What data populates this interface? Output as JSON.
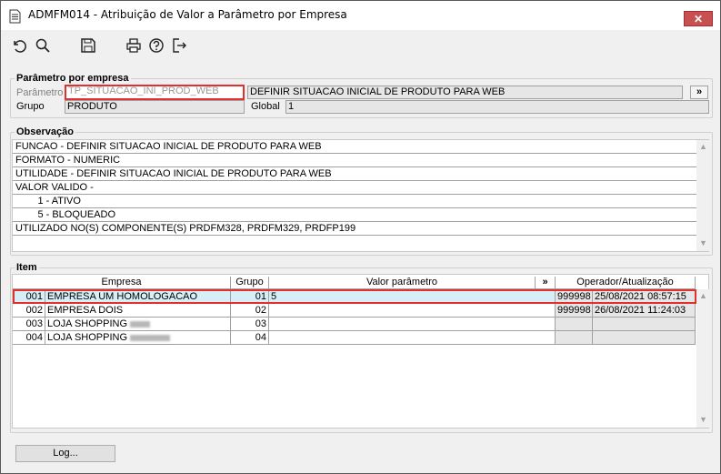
{
  "window": {
    "title": "ADMFM014 - Atribuição de Valor a Parâmetro por Empresa",
    "close_label": "✕"
  },
  "toolbar": {
    "icons": [
      "undo-icon",
      "search-icon",
      "save-icon",
      "print-icon",
      "help-icon",
      "exit-icon"
    ]
  },
  "parametro": {
    "legend": "Parâmetro por empresa",
    "parametro_label": "Parâmetro",
    "parametro_value": "TP_SITUACAO_INI_PROD_WEB",
    "descricao_value": "DEFINIR SITUACAO INICIAL DE PRODUTO PARA WEB",
    "lookup_label": "»",
    "grupo_label": "Grupo",
    "grupo_value": "PRODUTO",
    "global_label": "Global",
    "global_value": "1"
  },
  "observacao": {
    "legend": "Observação",
    "lines": [
      "FUNCAO - DEFINIR SITUACAO INICIAL DE PRODUTO PARA WEB",
      "FORMATO - NUMERIC",
      "UTILIDADE - DEFINIR SITUACAO INICIAL DE PRODUTO PARA WEB",
      "VALOR VALIDO -",
      "        1 - ATIVO",
      "        5 - BLOQUEADO",
      "UTILIZADO NO(S) COMPONENTE(S) PRDFM328, PRDFM329, PRDFP199"
    ]
  },
  "item": {
    "legend": "Item",
    "headers": {
      "empresa": "Empresa",
      "grupo": "Grupo",
      "valor": "Valor parâmetro",
      "expand": "»",
      "operador": "Operador/Atualização"
    },
    "rows": [
      {
        "code": "001",
        "name": "EMPRESA UM HOMOLOGACAO",
        "grupo": "01",
        "valor": "5",
        "operador": "999998",
        "data": "25/08/2021 08:57:15"
      },
      {
        "code": "002",
        "name": "EMPRESA DOIS",
        "grupo": "02",
        "valor": "",
        "operador": "999998",
        "data": "26/08/2021 11:24:03"
      },
      {
        "code": "003",
        "name": "LOJA SHOPPING",
        "grupo": "03",
        "valor": "",
        "operador": "",
        "data": ""
      },
      {
        "code": "004",
        "name": "LOJA SHOPPING",
        "grupo": "04",
        "valor": "",
        "operador": "",
        "data": ""
      }
    ]
  },
  "footer": {
    "log_label": "Log..."
  },
  "colors": {
    "highlight_border": "#e03030",
    "selected_row": "#d7eef6",
    "readonly_bg": "#e6e6e6"
  }
}
